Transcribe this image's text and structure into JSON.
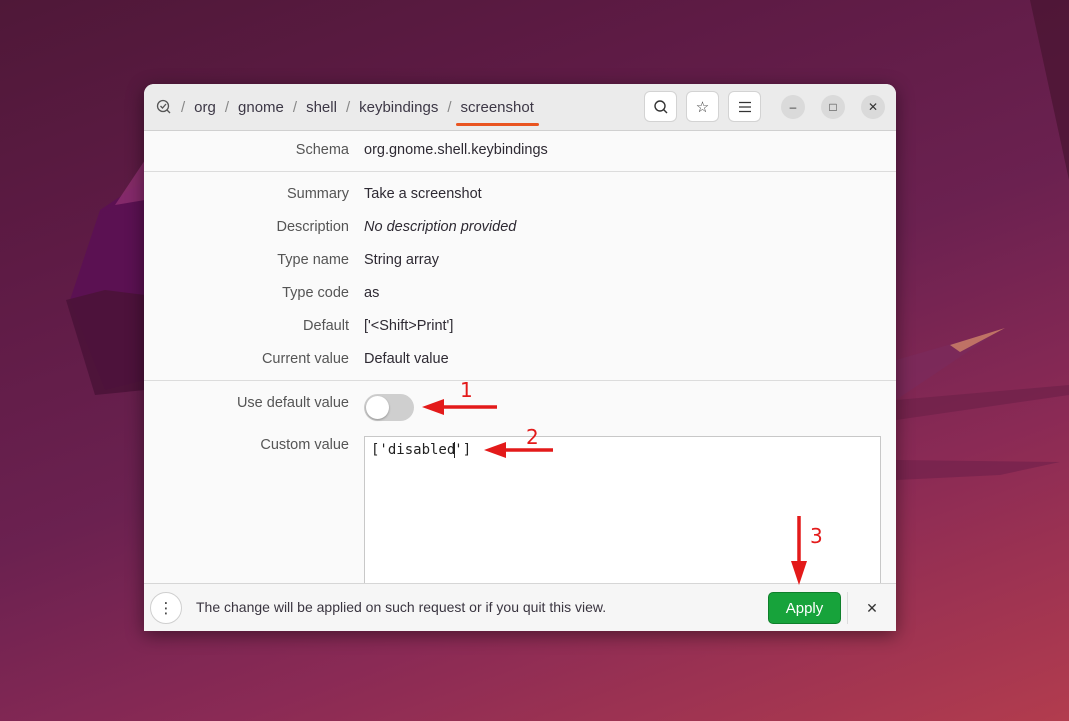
{
  "window": {
    "breadcrumb": [
      "org",
      "gnome",
      "shell",
      "keybindings",
      "screenshot"
    ],
    "separator": "/",
    "buttons": {
      "search_icon": "⌕",
      "bookmark_icon": "☆",
      "menu_icon": "☰",
      "minimize_icon": "–",
      "maximize_icon": "□",
      "close_icon": "✕"
    }
  },
  "properties": [
    {
      "label": "Schema",
      "value": "org.gnome.shell.keybindings"
    },
    {
      "label": "Summary",
      "value": "Take a screenshot"
    },
    {
      "label": "Description",
      "value": "No description provided"
    },
    {
      "label": "Type name",
      "value": "String array"
    },
    {
      "label": "Type code",
      "value": "as"
    },
    {
      "label": "Default",
      "value": "['<Shift>Print']"
    },
    {
      "label": "Current value",
      "value": "Default value"
    }
  ],
  "editor": {
    "use_default_label": "Use default value",
    "use_default_on": false,
    "custom_value_label": "Custom value",
    "custom_value_before_caret": "['disabled",
    "custom_value_after_caret": "']"
  },
  "footer": {
    "more_icon": "⋮",
    "message": "The change will be applied on such request or if you quit this view.",
    "apply_label": "Apply",
    "dismiss_icon": "✕"
  },
  "annotations": [
    "1",
    "2",
    "3"
  ],
  "colors": {
    "accent": "#e95420",
    "apply": "#17a33b",
    "annotation": "#e31a1a"
  }
}
